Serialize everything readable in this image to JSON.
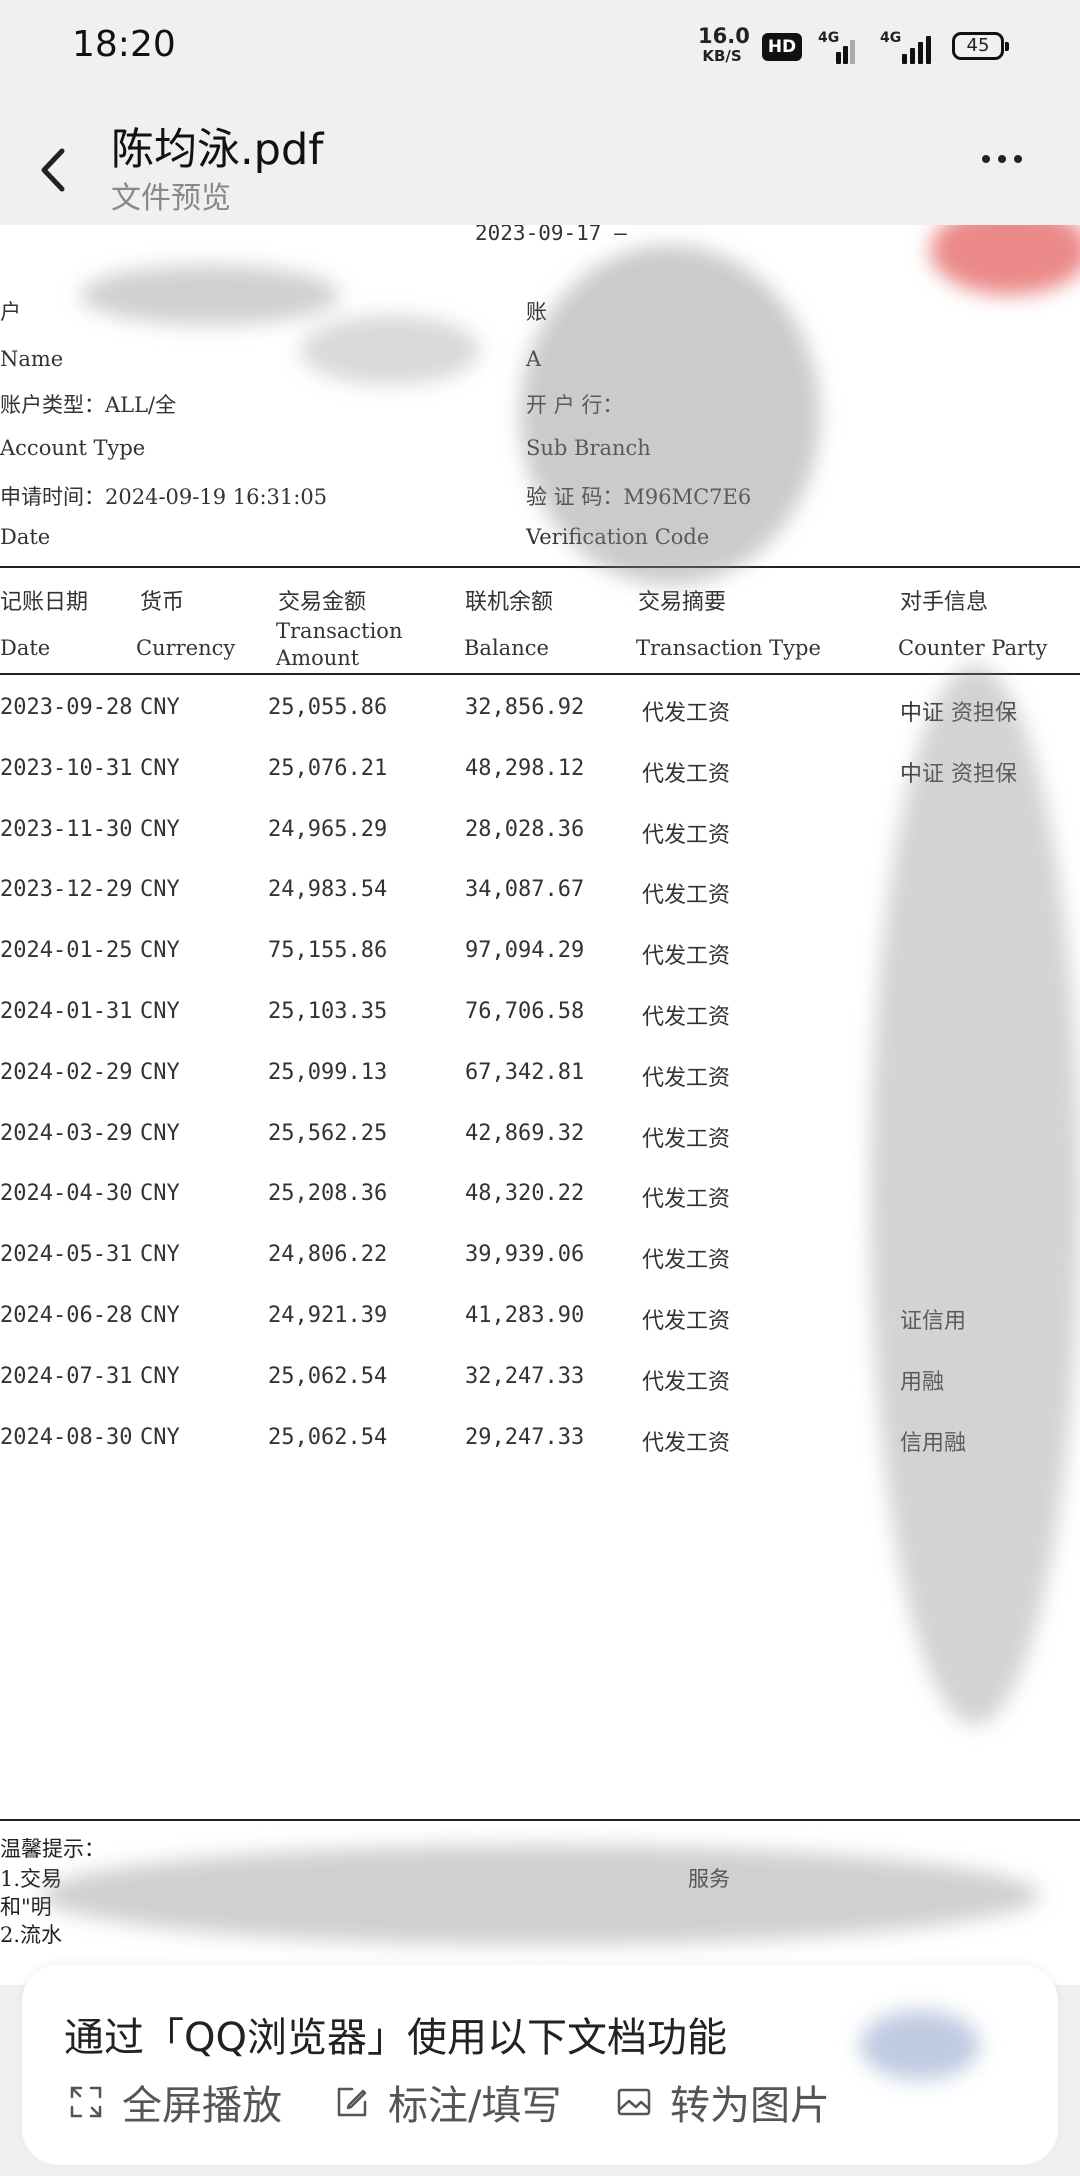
{
  "status": {
    "time": "18:20",
    "net_speed": "16.0",
    "net_unit": "KB/S",
    "hd": "HD",
    "sig1": "4G",
    "sig2": "4G",
    "battery": "45"
  },
  "header": {
    "title": "陈均泳.pdf",
    "subtitle": "文件预览"
  },
  "doc": {
    "period": "2023-09-17 —",
    "info": {
      "name_cn": "户",
      "name_en": "Name",
      "acct_cn": "账",
      "acct_en": "A",
      "type_cn": "账户类型：ALL/全",
      "type_en": "Account Type",
      "branch_cn": "开 户 行：",
      "branch_en": "Sub Branch",
      "date_cn": "申请时间：2024-09-19 16:31:05",
      "date_en": "Date",
      "code_cn": "验 证 码：M96MC7E6",
      "code_en": "Verification Code"
    },
    "columns": [
      {
        "cn": "记账日期",
        "en": "Date"
      },
      {
        "cn": "货币",
        "en": "Currency"
      },
      {
        "cn": "交易金额",
        "en": "Transaction Amount"
      },
      {
        "cn": "联机余额",
        "en": "Balance"
      },
      {
        "cn": "交易摘要",
        "en": "Transaction Type"
      },
      {
        "cn": "对手信息",
        "en": "Counter Party"
      }
    ],
    "rows": [
      {
        "date": "2023-09-28",
        "cur": "CNY",
        "amt": "25,055.86",
        "bal": "32,856.92",
        "type": "代发工资",
        "party": "中证 资担保"
      },
      {
        "date": "2023-10-31",
        "cur": "CNY",
        "amt": "25,076.21",
        "bal": "48,298.12",
        "type": "代发工资",
        "party": "中证 资担保"
      },
      {
        "date": "2023-11-30",
        "cur": "CNY",
        "amt": "24,965.29",
        "bal": "28,028.36",
        "type": "代发工资",
        "party": ""
      },
      {
        "date": "2023-12-29",
        "cur": "CNY",
        "amt": "24,983.54",
        "bal": "34,087.67",
        "type": "代发工资",
        "party": ""
      },
      {
        "date": "2024-01-25",
        "cur": "CNY",
        "amt": "75,155.86",
        "bal": "97,094.29",
        "type": "代发工资",
        "party": ""
      },
      {
        "date": "2024-01-31",
        "cur": "CNY",
        "amt": "25,103.35",
        "bal": "76,706.58",
        "type": "代发工资",
        "party": ""
      },
      {
        "date": "2024-02-29",
        "cur": "CNY",
        "amt": "25,099.13",
        "bal": "67,342.81",
        "type": "代发工资",
        "party": ""
      },
      {
        "date": "2024-03-29",
        "cur": "CNY",
        "amt": "25,562.25",
        "bal": "42,869.32",
        "type": "代发工资",
        "party": ""
      },
      {
        "date": "2024-04-30",
        "cur": "CNY",
        "amt": "25,208.36",
        "bal": "48,320.22",
        "type": "代发工资",
        "party": ""
      },
      {
        "date": "2024-05-31",
        "cur": "CNY",
        "amt": "24,806.22",
        "bal": "39,939.06",
        "type": "代发工资",
        "party": ""
      },
      {
        "date": "2024-06-28",
        "cur": "CNY",
        "amt": "24,921.39",
        "bal": "41,283.90",
        "type": "代发工资",
        "party": "证信用"
      },
      {
        "date": "2024-07-31",
        "cur": "CNY",
        "amt": "25,062.54",
        "bal": "32,247.33",
        "type": "代发工资",
        "party": "用融"
      },
      {
        "date": "2024-08-30",
        "cur": "CNY",
        "amt": "25,062.54",
        "bal": "29,247.33",
        "type": "代发工资",
        "party": "信用融"
      }
    ],
    "notes": {
      "title": "温馨提示：",
      "line1": "1.交易",
      "line2": "和\"明",
      "line3": "2.流水",
      "service": "服务"
    }
  },
  "sheet": {
    "promo": "通过「QQ浏览器」使用以下文档功能",
    "features": [
      {
        "label": "全屏播放",
        "icon": "fullscreen-icon"
      },
      {
        "label": "标注/填写",
        "icon": "edit-icon"
      },
      {
        "label": "转为图片",
        "icon": "image-icon"
      }
    ]
  }
}
